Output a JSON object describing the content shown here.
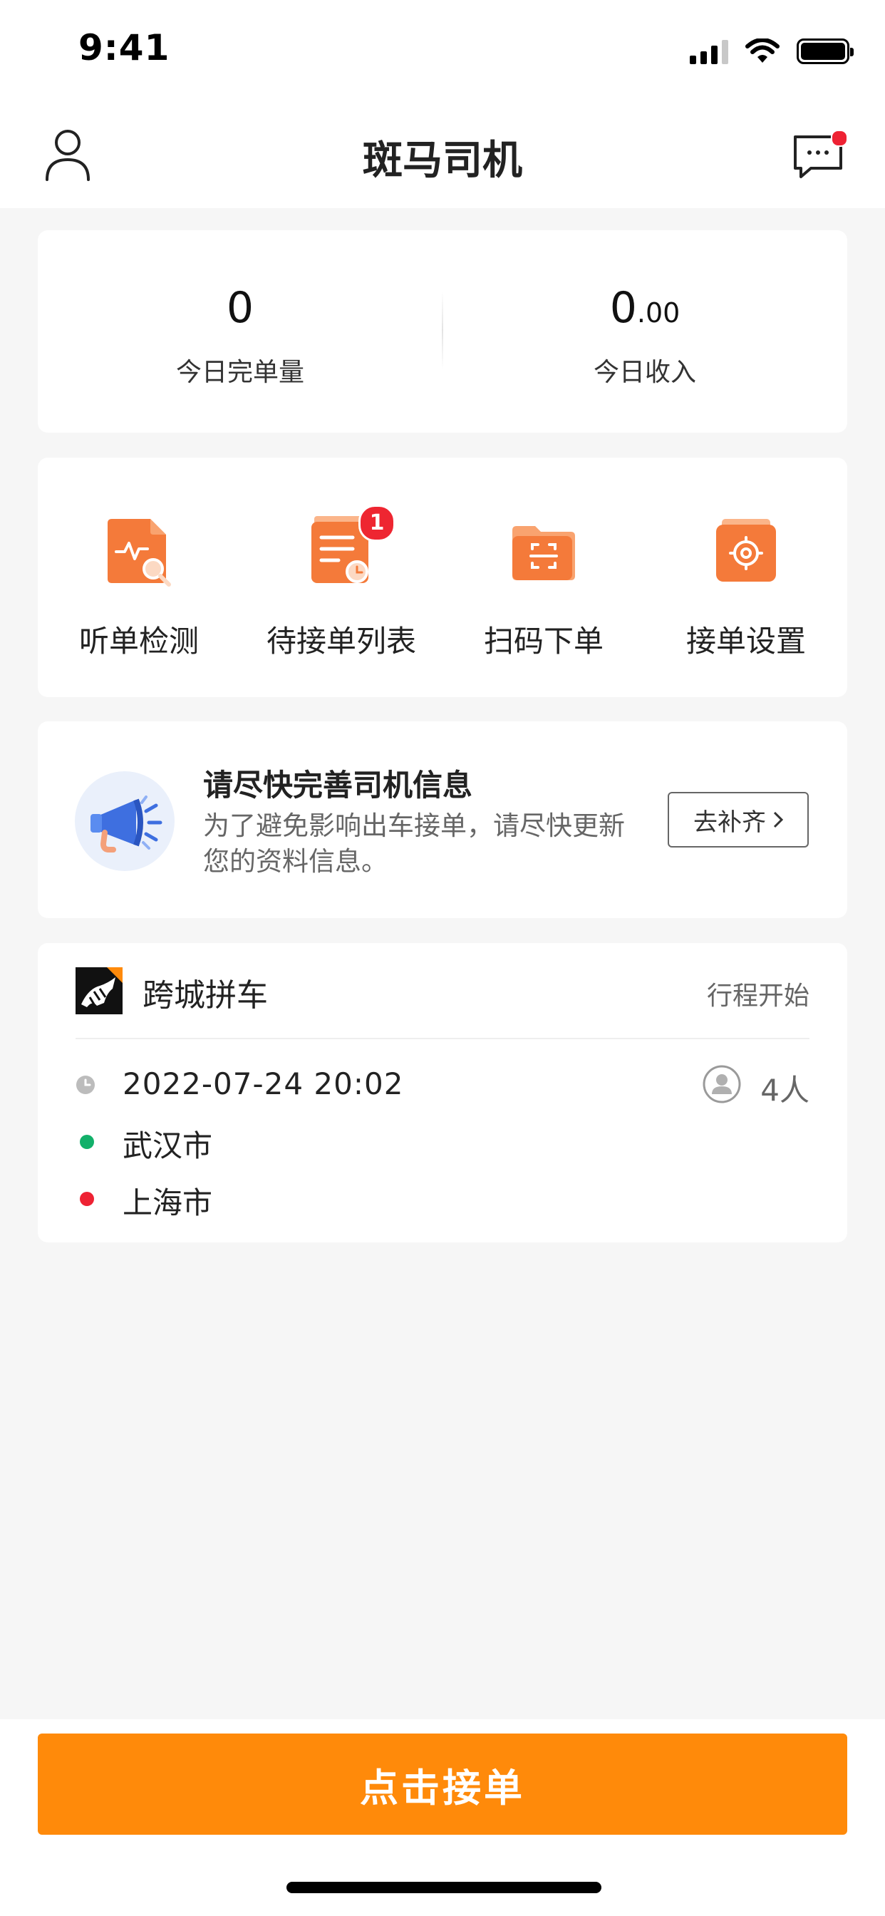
{
  "status_bar": {
    "time": "9:41"
  },
  "header": {
    "title": "斑马司机",
    "user_icon": "user-icon",
    "message_icon": "message-icon"
  },
  "stats": {
    "orders_value": "0",
    "orders_label": "今日完单量",
    "income_int": "0",
    "income_dec": ".00",
    "income_label": "今日收入"
  },
  "actions": [
    {
      "label": "听单检测",
      "icon": "listen-detect-icon"
    },
    {
      "label": "待接单列表",
      "icon": "pending-list-icon",
      "badge": "1"
    },
    {
      "label": "扫码下单",
      "icon": "scan-order-icon"
    },
    {
      "label": "接单设置",
      "icon": "order-settings-icon"
    }
  ],
  "notice": {
    "title": "请尽快完善司机信息",
    "text": "为了避免影响出车接单，请尽快更新您的资料信息。",
    "button": "去补齐"
  },
  "trip": {
    "type": "跨城拼车",
    "status": "行程开始",
    "datetime": "2022-07-24  20:02",
    "passengers": "4人",
    "from": "武汉市",
    "to": "上海市"
  },
  "bottom": {
    "accept_label": "点击接单"
  },
  "colors": {
    "accent": "#ff8a0a",
    "icon_orange": "#f47a3a",
    "badge": "#ee2631",
    "green": "#12b06a",
    "red": "#ee2233"
  }
}
